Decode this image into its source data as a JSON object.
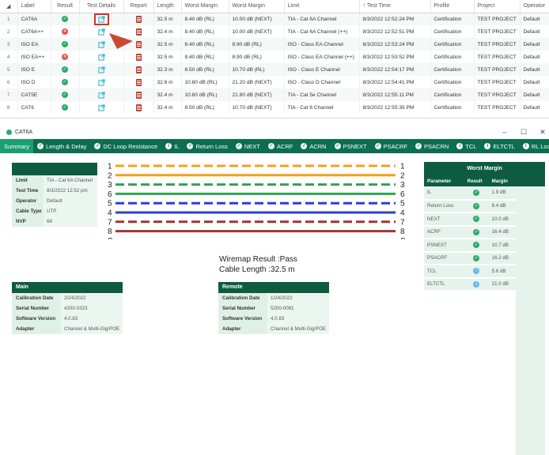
{
  "grid": {
    "columns": [
      "Label",
      "Result",
      "Test Details",
      "Report",
      "Length",
      "Worst Margin",
      "Worst Margin",
      "Limit",
      "Test Time",
      "Profile",
      "Project",
      "Operator"
    ],
    "rows": [
      {
        "num": "1",
        "label": "CAT6A",
        "result": "pass",
        "length": "32.5 m",
        "wm1": "8.40 dB (RL)",
        "wm2": "10.00 dB (NEXT)",
        "limit": "TIA - Cat 6A Channel",
        "time": "8/3/2022 12:52:24 PM",
        "profile": "Certification",
        "project": "TEST PROJECT",
        "operator": "Default"
      },
      {
        "num": "2",
        "label": "CAT6A++",
        "result": "fail",
        "length": "32.4 m",
        "wm1": "8.40 dB (RL)",
        "wm2": "10.00 dB (NEXT)",
        "limit": "TIA - Cat 6A Channel (++)",
        "time": "8/3/2022 12:52:51 PM",
        "profile": "Certification",
        "project": "TEST PROJECT",
        "operator": "Default"
      },
      {
        "num": "3",
        "label": "ISO EA",
        "result": "pass",
        "length": "32.5 m",
        "wm1": "8.40 dB (RL)",
        "wm2": "8.90 dB (RL)",
        "limit": "ISO - Class EA Channel",
        "time": "8/3/2022 12:53:24 PM",
        "profile": "Certification",
        "project": "TEST PROJECT",
        "operator": "Default"
      },
      {
        "num": "4",
        "label": "ISO EA++",
        "result": "fail",
        "length": "32.5 m",
        "wm1": "8.40 dB (RL)",
        "wm2": "8.90 dB (RL)",
        "limit": "ISO - Class EA Channel (++)",
        "time": "8/3/2022 12:53:52 PM",
        "profile": "Certification",
        "project": "TEST PROJECT",
        "operator": "Default"
      },
      {
        "num": "5",
        "label": "ISO E",
        "result": "pass",
        "length": "32.3 m",
        "wm1": "8.50 dB (RL)",
        "wm2": "10.70 dB (RL)",
        "limit": "ISO - Class E Channel",
        "time": "8/3/2022 12:54:17 PM",
        "profile": "Certification",
        "project": "TEST PROJECT",
        "operator": "Default"
      },
      {
        "num": "6",
        "label": "ISO D",
        "result": "pass",
        "length": "32.6 m",
        "wm1": "10.80 dB (RL)",
        "wm2": "21.20 dB (NEXT)",
        "limit": "ISO - Class D Channel",
        "time": "8/3/2022 12:54:41 PM",
        "profile": "Certification",
        "project": "TEST PROJECT",
        "operator": "Default"
      },
      {
        "num": "7",
        "label": "CAT5E",
        "result": "pass",
        "length": "32.4 m",
        "wm1": "10.80 dB (RL)",
        "wm2": "21.80 dB (NEXT)",
        "limit": "TIA - Cat 5e Channel",
        "time": "8/3/2022 12:55:11 PM",
        "profile": "Certification",
        "project": "TEST PROJECT",
        "operator": "Default"
      },
      {
        "num": "8",
        "label": "CAT6",
        "result": "pass",
        "length": "32.4 m",
        "wm1": "8.50 dB (RL)",
        "wm2": "10.70 dB (NEXT)",
        "limit": "TIA - Cat 6 Channel",
        "time": "8/3/2022 12:55:35 PM",
        "profile": "Certification",
        "project": "TEST PROJECT",
        "operator": "Default"
      }
    ]
  },
  "window": {
    "title": "CAT6A",
    "tabs": [
      "Summary",
      "Length & Delay",
      "DC Loop Resistance",
      "IL",
      "Return Loss",
      "NEXT",
      "ACRF",
      "ACRN",
      "PSNEXT",
      "PSACRF",
      "PSACRN",
      "TCL",
      "ELTCTL",
      "RL Local"
    ]
  },
  "summary": {
    "rows": [
      {
        "k": "Limit",
        "v": "TIA - Cat 6A Channel"
      },
      {
        "k": "Test Time",
        "v": "8/3/2022 12:52 pm"
      },
      {
        "k": "Operator",
        "v": "Default"
      },
      {
        "k": "Cable Type",
        "v": "UTP"
      },
      {
        "k": "NVP",
        "v": "68"
      }
    ]
  },
  "main": {
    "title": "Main",
    "rows": [
      {
        "k": "Calibration Date",
        "v": "2/24/2022"
      },
      {
        "k": "Serial Number",
        "v": "4200-0323"
      },
      {
        "k": "Software Version",
        "v": "4.0.83"
      },
      {
        "k": "Adapter",
        "v": "Channel & Multi-Gig/POE"
      }
    ]
  },
  "remote": {
    "title": "Remote",
    "rows": [
      {
        "k": "Calibration Date",
        "v": "1/24/2022"
      },
      {
        "k": "Serial Number",
        "v": "5200-0081"
      },
      {
        "k": "Software Version",
        "v": "4.0.83"
      },
      {
        "k": "Adapter",
        "v": "Channel & Multi-Gig/POE"
      }
    ]
  },
  "wiremap": {
    "pins_left": [
      "1",
      "2",
      "3",
      "6",
      "5",
      "4",
      "7",
      "8",
      "S"
    ],
    "pins_right": [
      "1",
      "2",
      "3",
      "6",
      "5",
      "4",
      "7",
      "8",
      "S"
    ],
    "colors": [
      "#f2a21c",
      "#f2a21c",
      "#2ea44f",
      "#2ea44f",
      "#2a3fd6",
      "#2a3fd6",
      "#a0362e",
      "#a0362e",
      "#222222"
    ],
    "dashed": [
      true,
      false,
      true,
      false,
      true,
      false,
      true,
      false,
      false
    ],
    "result_line1": "Wiremap Result :Pass",
    "result_line2": "Cable Length :32.5 m"
  },
  "worst_margin": {
    "title": "Worst Margin",
    "headers": [
      "Parameter",
      "Result",
      "Margin"
    ],
    "rows": [
      {
        "p": "IL",
        "r": "pass",
        "m": "1.9 dB"
      },
      {
        "p": "Return Loss",
        "r": "pass",
        "m": "8.4 dB"
      },
      {
        "p": "NEXT",
        "r": "pass",
        "m": "10.0 dB"
      },
      {
        "p": "ACRF",
        "r": "pass",
        "m": "16.4 dB"
      },
      {
        "p": "PSNEXT",
        "r": "pass",
        "m": "10.7 dB"
      },
      {
        "p": "PSACRF",
        "r": "pass",
        "m": "16.2 dB"
      },
      {
        "p": "TCL",
        "r": "info",
        "m": "5.6 dB"
      },
      {
        "p": "ELTCTL",
        "r": "info",
        "m": "21.0 dB"
      }
    ]
  },
  "colors": {
    "brand_dark": "#0d5c42",
    "tab_bar": "#0d6e4f",
    "tab_active": "#1aa06f",
    "pass": "#2ea86b",
    "fail": "#e2544a",
    "highlight": "#d9302a"
  }
}
